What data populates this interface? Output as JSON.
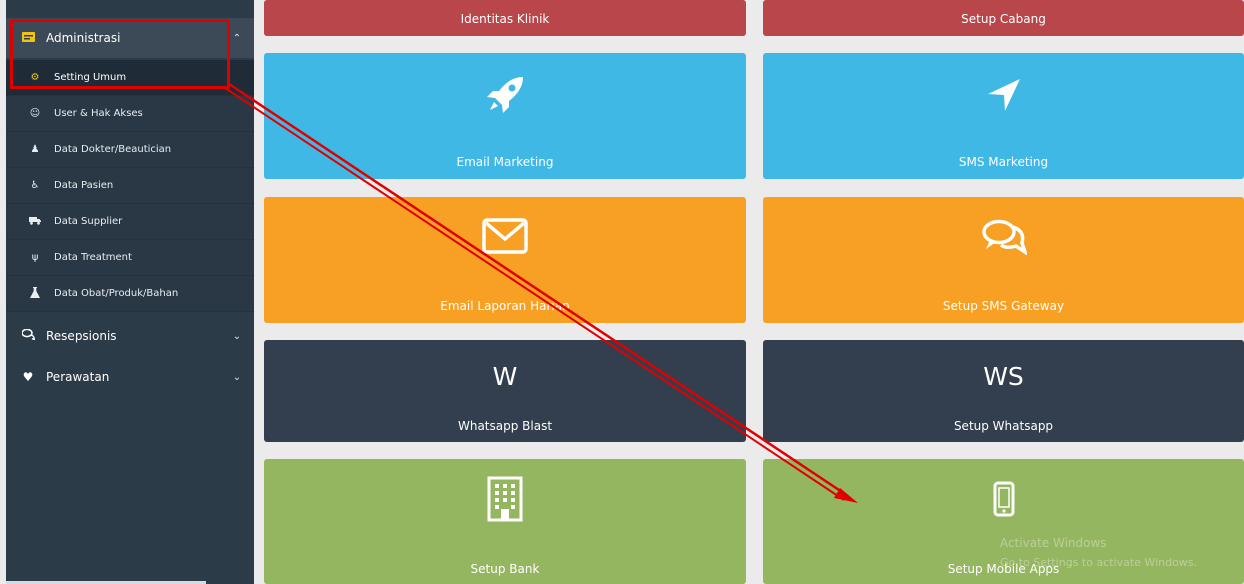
{
  "sidebar": {
    "groups": [
      {
        "label": "Administrasi",
        "icon": "id-card-icon"
      },
      {
        "label": "Resepsionis",
        "icon": "comments-icon"
      },
      {
        "label": "Perawatan",
        "icon": "heart-icon"
      }
    ],
    "items": [
      {
        "label": "Setting Umum",
        "icon": "gear-icon"
      },
      {
        "label": "User & Hak Akses",
        "icon": "smile-icon"
      },
      {
        "label": "Data Dokter/Beautician",
        "icon": "user-md-icon"
      },
      {
        "label": "Data Pasien",
        "icon": "wheelchair-icon"
      },
      {
        "label": "Data Supplier",
        "icon": "truck-icon"
      },
      {
        "label": "Data Treatment",
        "icon": "stethoscope-icon"
      },
      {
        "label": "Data Obat/Produk/Bahan",
        "icon": "flask-icon"
      }
    ]
  },
  "tiles": [
    {
      "label": "Identitas Klinik",
      "icon": "",
      "color": "#b9464a"
    },
    {
      "label": "Setup Cabang",
      "icon": "",
      "color": "#b9464a"
    },
    {
      "label": "Email Marketing",
      "icon": "rocket-icon",
      "color": "#40b8e6"
    },
    {
      "label": "SMS Marketing",
      "icon": "location-arrow-icon",
      "color": "#40b8e6"
    },
    {
      "label": "Email Laporan Harian",
      "icon": "envelope-icon",
      "color": "#f8a024"
    },
    {
      "label": "Setup SMS Gateway",
      "icon": "comments-icon",
      "color": "#f8a024"
    },
    {
      "label": "Whatsapp Blast",
      "icon_text": "W",
      "color": "#333f4e"
    },
    {
      "label": "Setup Whatsapp",
      "icon_text": "WS",
      "color": "#333f4e"
    },
    {
      "label": "Setup Bank",
      "icon": "building-icon",
      "color": "#95b660"
    },
    {
      "label": "Setup Mobile Apps",
      "icon": "mobile-phone-icon",
      "color": "#95b660"
    }
  ],
  "watermark": {
    "line1": "Activate Windows",
    "line2": "Go to Settings to activate Windows."
  },
  "annotation": {
    "color": "#e00000"
  }
}
